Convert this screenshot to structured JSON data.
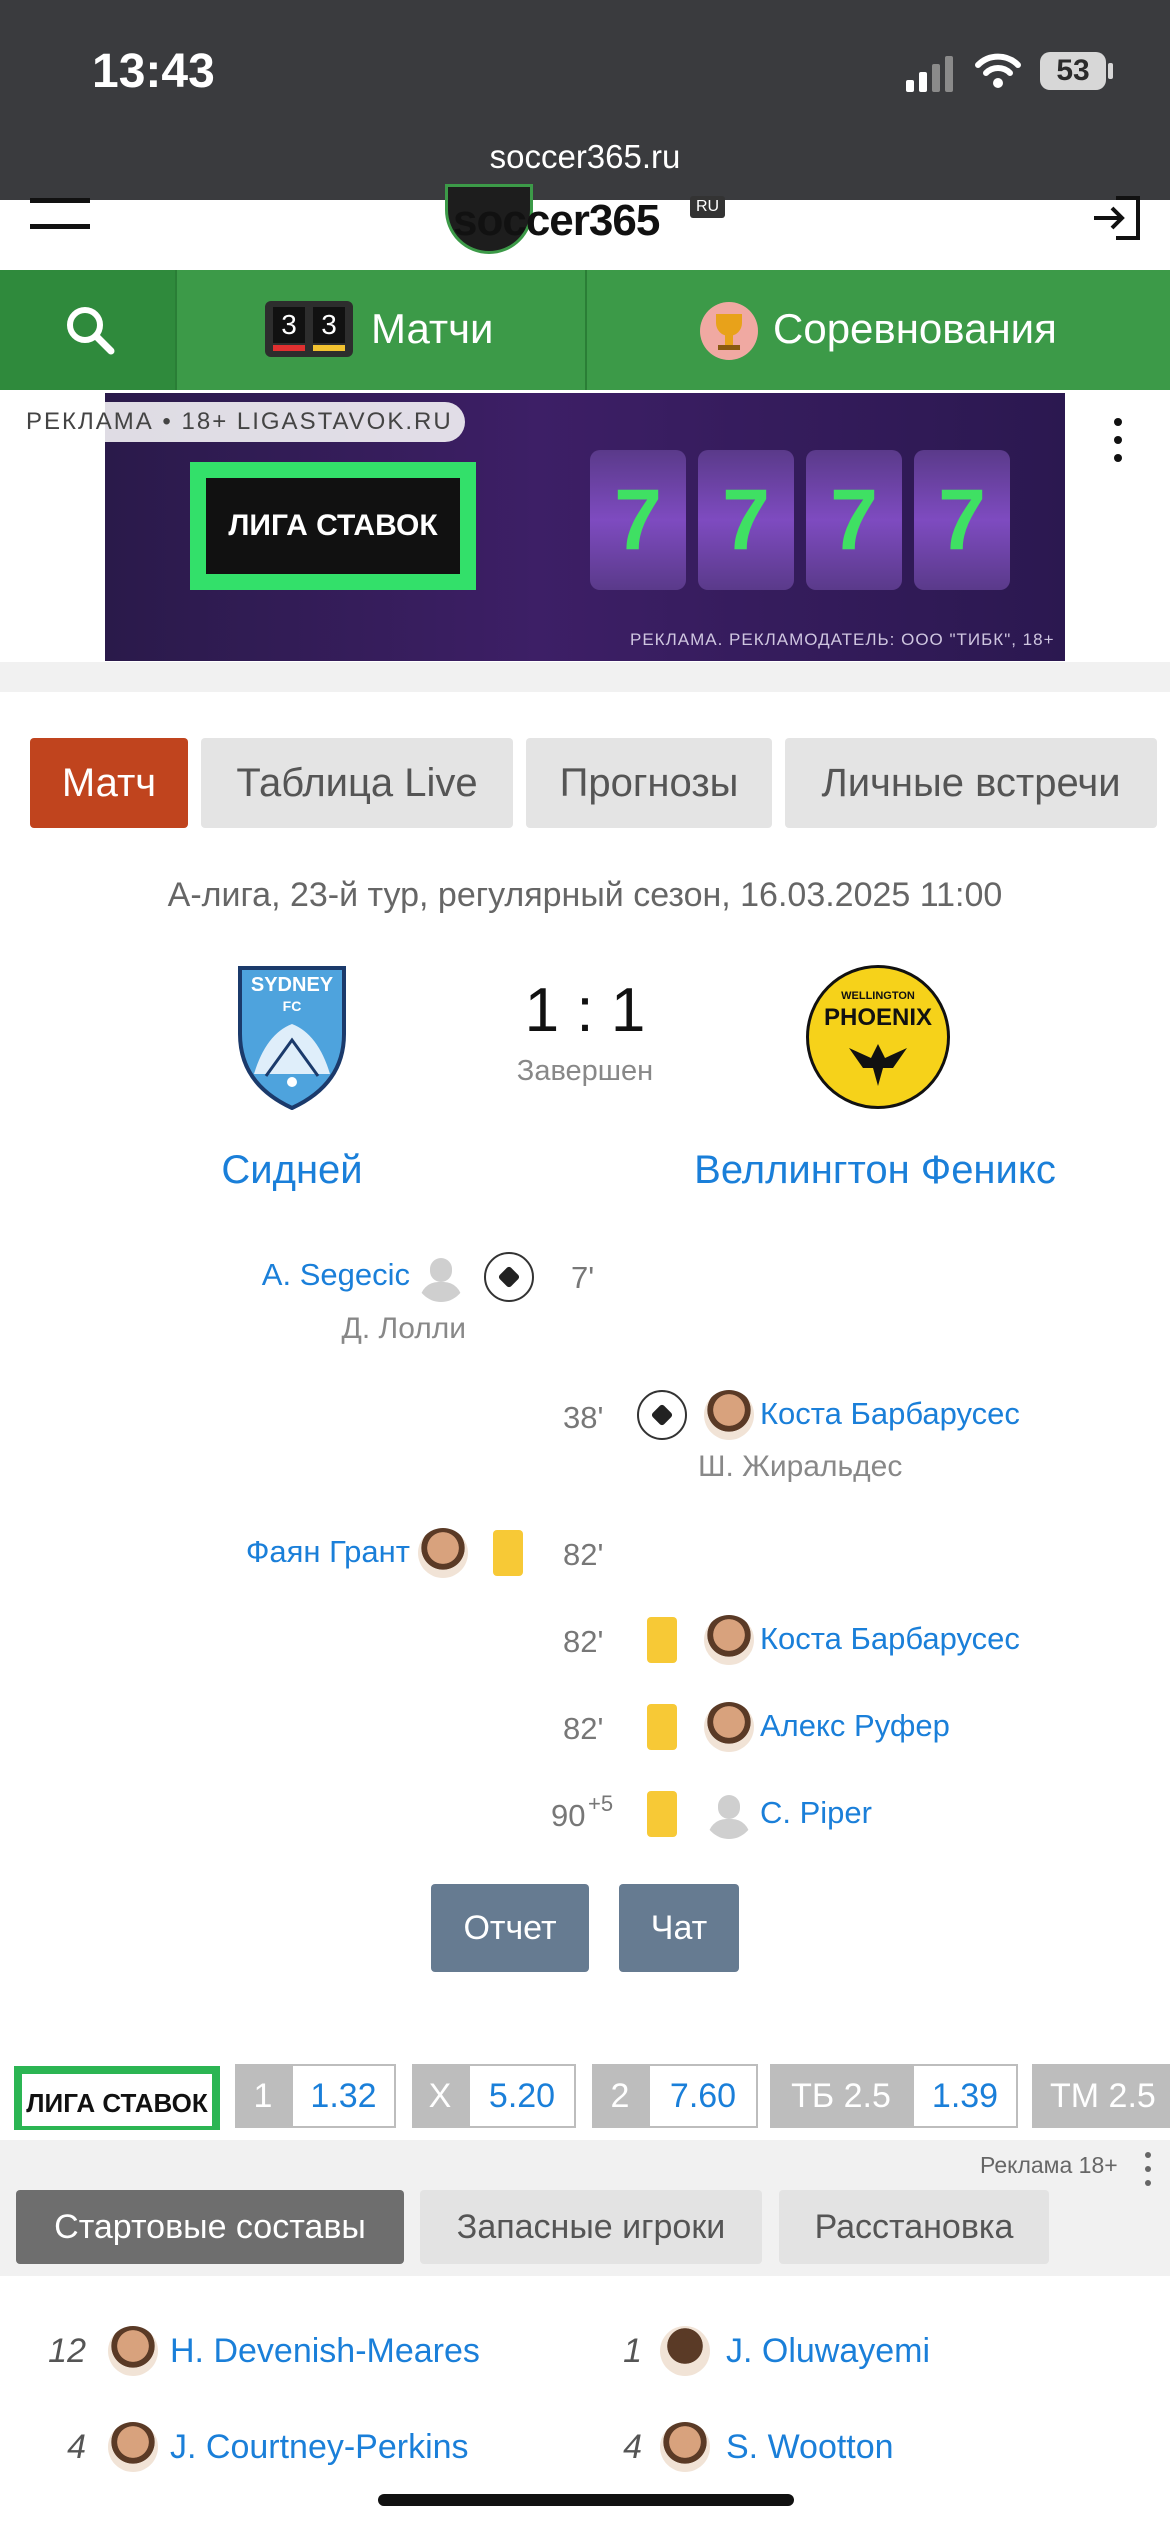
{
  "status_bar": {
    "time": "13:43",
    "battery": "53",
    "url": "soccer365.ru"
  },
  "site": {
    "logo_text": "soccer365",
    "logo_badge": "RU"
  },
  "nav": {
    "matches_label": "Матчи",
    "competitions_label": "Соревнования",
    "mini_score": [
      "3",
      "3"
    ]
  },
  "ad": {
    "tag": "РЕКЛАМА • 18+ LIGASTAVOK.RU",
    "logo_text": "ЛИГА СТАВОК",
    "slot_digits": [
      "7",
      "7",
      "7",
      "7"
    ],
    "footer": "РЕКЛАМА. РЕКЛАМОДАТЕЛЬ: ООО \"ТИБК\", 18+"
  },
  "tabs": [
    "Матч",
    "Таблица Live",
    "Прогнозы",
    "Личные встречи"
  ],
  "match": {
    "info": "А-лига, 23-й тур, регулярный сезон, 16.03.2025 11:00",
    "score": "1 : 1",
    "status": "Завершен",
    "home": {
      "name": "Сидней",
      "logo_text": [
        "SYDNEY",
        "FC"
      ]
    },
    "away": {
      "name": "Веллингтон Феникс",
      "logo_text": [
        "WELLINGTON",
        "PHOENIX"
      ]
    }
  },
  "events": [
    {
      "side": "home",
      "type": "goal",
      "minute": "7'",
      "player": "A. Segecic",
      "assist": "Д. Лолли"
    },
    {
      "side": "away",
      "type": "goal",
      "minute": "38'",
      "player": "Коста Барбарусес",
      "assist": "Ш. Жиральдес"
    },
    {
      "side": "home",
      "type": "yellow",
      "minute": "82'",
      "player": "Фаян Грант"
    },
    {
      "side": "away",
      "type": "yellow",
      "minute": "82'",
      "player": "Коста Барбарусес"
    },
    {
      "side": "away",
      "type": "yellow",
      "minute": "82'",
      "player": "Алекс Руфер"
    },
    {
      "side": "away",
      "type": "yellow",
      "minute": "90",
      "minute_extra": "+5",
      "player": "C. Piper"
    }
  ],
  "buttons": {
    "report": "Отчет",
    "chat": "Чат"
  },
  "odds": {
    "logo_text": "ЛИГА СТАВОК",
    "items": [
      {
        "key": "1",
        "value": "1.32"
      },
      {
        "key": "X",
        "value": "5.20"
      },
      {
        "key": "2",
        "value": "7.60"
      },
      {
        "key": "ТБ 2.5",
        "value": "1.39"
      },
      {
        "key": "ТМ 2.5",
        "value": ""
      }
    ],
    "ad_note": "Реклама 18+"
  },
  "lineup_tabs": [
    "Стартовые составы",
    "Запасные игроки",
    "Расстановка"
  ],
  "lineups": {
    "home": [
      {
        "num": "12",
        "name": "H. Devenish-Meares"
      },
      {
        "num": "4",
        "name": "J. Courtney-Perkins"
      }
    ],
    "away": [
      {
        "num": "1",
        "name": "J. Oluwayemi"
      },
      {
        "num": "4",
        "name": "S. Wootton"
      }
    ]
  },
  "colors": {
    "nav_green": "#3c9a48",
    "active_tab": "#c0441e",
    "link_blue": "#1a7fd9",
    "button_slate": "#667b91",
    "yellow_card": "#f7c936"
  }
}
